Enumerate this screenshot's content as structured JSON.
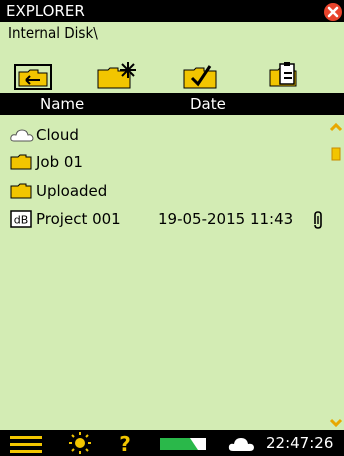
{
  "window": {
    "title": "EXPLORER",
    "path": "Internal Disk\\"
  },
  "columns": {
    "name": "Name",
    "date": "Date"
  },
  "items": [
    {
      "icon": "cloud-icon",
      "label": "Cloud"
    },
    {
      "icon": "folder-icon",
      "label": "Job 01"
    },
    {
      "icon": "folder-icon",
      "label": "Uploaded"
    },
    {
      "icon": "db-file-icon",
      "label": "Project 001",
      "date": "19-05-2015 11:43"
    }
  ],
  "status": {
    "time": "22:47:26"
  },
  "colors": {
    "background": "#d3ecb4",
    "bars": "#000000",
    "close": "#e8442c",
    "accent_yellow": "#f2c500",
    "battery_green": "#2ab84a"
  }
}
